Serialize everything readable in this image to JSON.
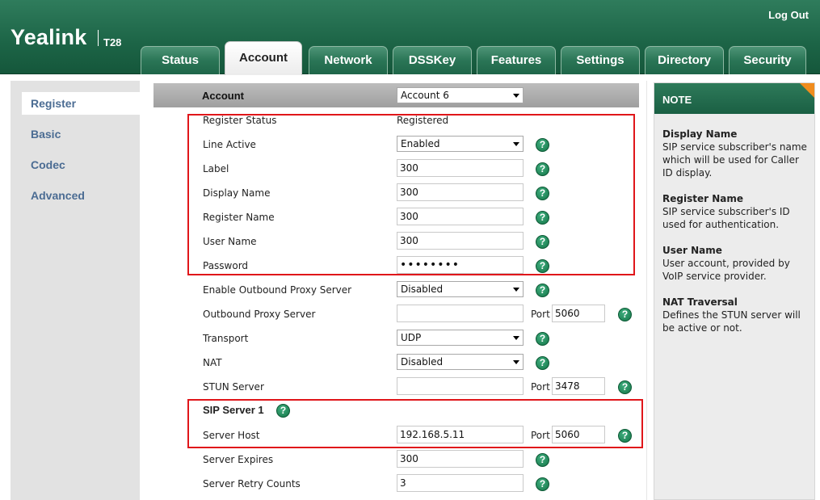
{
  "header": {
    "brand": "Yealink",
    "model": "T28",
    "logout": "Log Out"
  },
  "tabs": [
    {
      "label": "Status"
    },
    {
      "label": "Account",
      "active": true
    },
    {
      "label": "Network"
    },
    {
      "label": "DSSKey"
    },
    {
      "label": "Features"
    },
    {
      "label": "Settings"
    },
    {
      "label": "Directory"
    },
    {
      "label": "Security"
    }
  ],
  "sidebar": {
    "items": [
      {
        "label": "Register",
        "active": true
      },
      {
        "label": "Basic"
      },
      {
        "label": "Codec"
      },
      {
        "label": "Advanced"
      }
    ]
  },
  "account": {
    "label": "Account",
    "selected": "Account 6"
  },
  "form": {
    "register_status": {
      "label": "Register Status",
      "value": "Registered"
    },
    "line_active": {
      "label": "Line Active",
      "value": "Enabled"
    },
    "label": {
      "label": "Label",
      "value": "300"
    },
    "display_name": {
      "label": "Display Name",
      "value": "300"
    },
    "register_name": {
      "label": "Register Name",
      "value": "300"
    },
    "user_name": {
      "label": "User Name",
      "value": "300"
    },
    "password": {
      "label": "Password",
      "value": "••••••••"
    },
    "outbound_proxy_enable": {
      "label": "Enable Outbound Proxy Server",
      "value": "Disabled"
    },
    "outbound_proxy": {
      "label": "Outbound Proxy Server",
      "value": "",
      "port_label": "Port",
      "port": "5060"
    },
    "transport": {
      "label": "Transport",
      "value": "UDP"
    },
    "nat": {
      "label": "NAT",
      "value": "Disabled"
    },
    "stun_server": {
      "label": "STUN Server",
      "value": "",
      "port_label": "Port",
      "port": "3478"
    },
    "sip_server_heading": "SIP Server 1",
    "server_host": {
      "label": "Server Host",
      "value": "192.168.5.11",
      "port_label": "Port",
      "port": "5060"
    },
    "server_expires": {
      "label": "Server Expires",
      "value": "300"
    },
    "server_retry": {
      "label": "Server Retry Counts",
      "value": "3"
    }
  },
  "help_glyph": "?",
  "note": {
    "title": "NOTE",
    "entries": [
      {
        "heading": "Display Name",
        "text": "SIP service subscriber's name which will be used for Caller ID display."
      },
      {
        "heading": "Register Name",
        "text": "SIP service subscriber's ID used for authentication."
      },
      {
        "heading": "User Name",
        "text": "User account, provided by VoIP service provider."
      },
      {
        "heading": "NAT Traversal",
        "text": "Defines the STUN server will be active or not."
      }
    ]
  },
  "colors": {
    "header_green": "#1c6446",
    "highlight_red": "#e0161a",
    "note_corner": "#f08c1d",
    "sidebar_link": "#4b6c93"
  }
}
